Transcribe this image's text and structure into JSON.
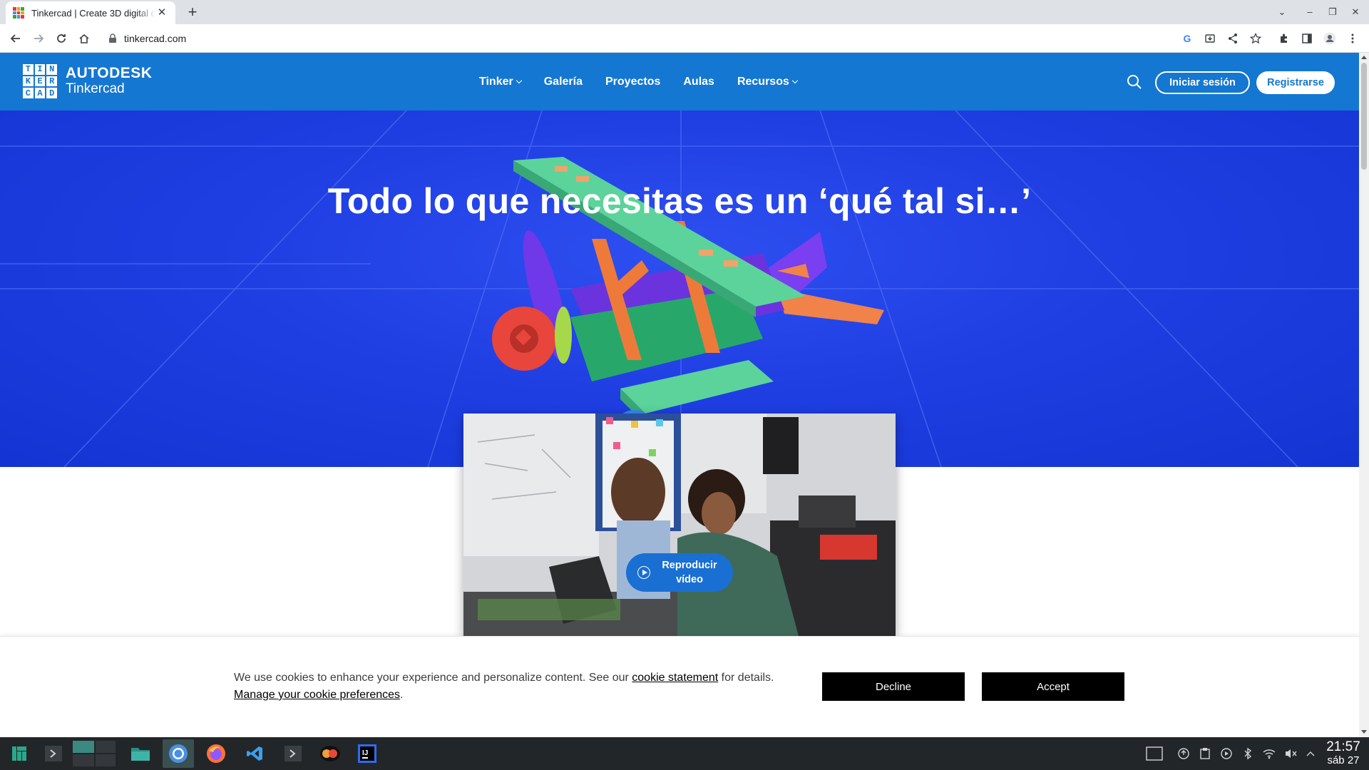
{
  "browser": {
    "tab_title": "Tinkercad | Create 3D digital designs with online CAD",
    "url": "tinkercad.com"
  },
  "header": {
    "logo_letters": [
      "T",
      "I",
      "N",
      "K",
      "E",
      "R",
      "C",
      "A",
      "D"
    ],
    "brand": "AUTODESK",
    "product": "Tinkercad",
    "nav": [
      {
        "label": "Tinker",
        "dropdown": true
      },
      {
        "label": "Galería",
        "dropdown": false
      },
      {
        "label": "Proyectos",
        "dropdown": false
      },
      {
        "label": "Aulas",
        "dropdown": false
      },
      {
        "label": "Recursos",
        "dropdown": true
      }
    ],
    "login": "Iniciar sesión",
    "register": "Registrarse"
  },
  "hero": {
    "title": "Todo lo que necesitas es un ‘qué tal si…’",
    "play_label": "Reproducir vídeo"
  },
  "cookie": {
    "text_before": "We use cookies to enhance your experience and personalize content. See our ",
    "link1": "cookie statement",
    "text_after": " for details.",
    "link2": "Manage your cookie preferences",
    "period": ".",
    "decline": "Decline",
    "accept": "Accept"
  },
  "taskbar": {
    "time": "21:57",
    "date": "sáb 27"
  },
  "colors": {
    "header_blue": "#1477d1",
    "hero_blue": "#1f3fe3",
    "banner_button": "#000000"
  }
}
